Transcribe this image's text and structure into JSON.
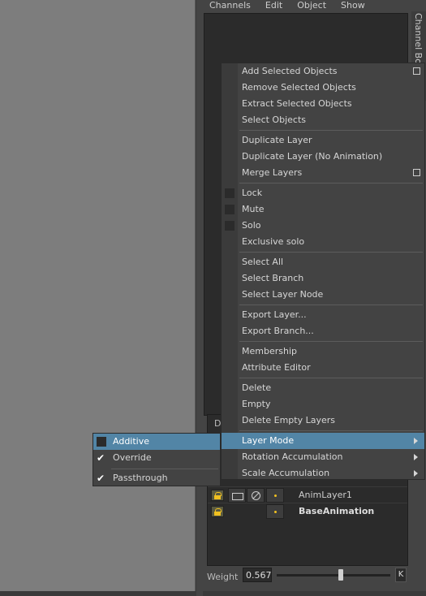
{
  "channel_box": {
    "menubar": [
      "Channels",
      "Edit",
      "Object",
      "Show"
    ],
    "side_tab_label": "Channel Box / Layer"
  },
  "context_menu": {
    "items": [
      {
        "label": "Add Selected Objects",
        "option_box": true
      },
      {
        "label": "Remove Selected Objects"
      },
      {
        "label": "Extract Selected Objects"
      },
      {
        "label": "Select Objects"
      },
      {
        "label": "Duplicate Layer"
      },
      {
        "label": "Duplicate Layer (No Animation)"
      },
      {
        "label": "Merge Layers",
        "option_box": true
      },
      {
        "label": "Lock",
        "checkbox": true
      },
      {
        "label": "Mute",
        "checkbox": true
      },
      {
        "label": "Solo",
        "checkbox": true
      },
      {
        "label": "Exclusive solo"
      },
      {
        "label": "Select All"
      },
      {
        "label": "Select Branch"
      },
      {
        "label": "Select Layer Node"
      },
      {
        "label": "Export Layer..."
      },
      {
        "label": "Export Branch..."
      },
      {
        "label": "Membership"
      },
      {
        "label": "Attribute Editor"
      },
      {
        "label": "Delete"
      },
      {
        "label": "Empty"
      },
      {
        "label": "Delete Empty Layers"
      },
      {
        "label": "Layer Mode",
        "submenu": true,
        "highlighted": true
      },
      {
        "label": "Rotation Accumulation",
        "submenu": true
      },
      {
        "label": "Scale Accumulation",
        "submenu": true
      }
    ]
  },
  "layer_mode_submenu": {
    "items": [
      {
        "label": "Additive",
        "checked": false,
        "highlighted": true
      },
      {
        "label": "Override",
        "checked": true
      },
      {
        "label": "Passthrough",
        "checked": true
      }
    ]
  },
  "layer_editor": {
    "header_letter": "D",
    "layers": [
      {
        "name": "AnimLayer1"
      },
      {
        "name": "BaseAnimation",
        "bold": true
      }
    ],
    "weight_label": "Weight",
    "weight_value": "0.567",
    "weight_fraction": 0.567,
    "key_label": "K"
  }
}
